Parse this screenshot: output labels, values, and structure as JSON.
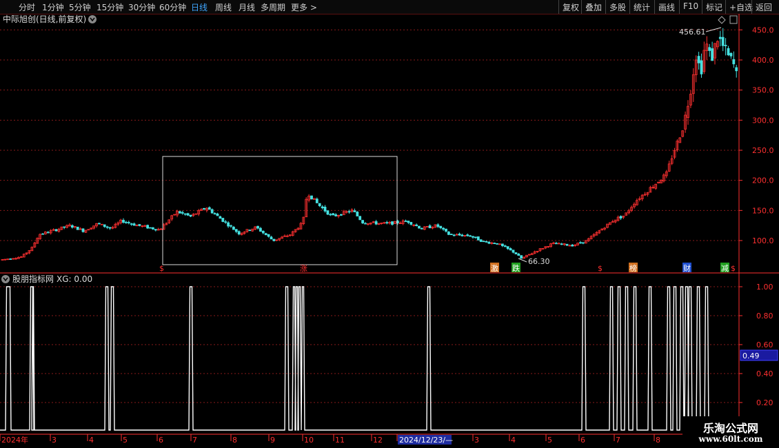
{
  "toolbar": {
    "left": [
      "分时",
      "1分钟",
      "5分钟",
      "15分钟",
      "30分钟",
      "60分钟",
      "日线",
      "周线",
      "月线",
      "多周期",
      "更多 >"
    ],
    "active": "日线",
    "right": [
      "复权",
      "叠加",
      "多股",
      "统计",
      "画线",
      "F10",
      "标记",
      "+自选",
      "返回"
    ]
  },
  "colors": {
    "up": "#ff3030",
    "down": "#45e0e0",
    "grid": "#8a1a1a",
    "axis": "#ff3030",
    "indicator": "#ffffff",
    "date_highlight": "#1e2ca0"
  },
  "main_chart": {
    "title": "中际旭创(日线,前复权)",
    "y_ticks": [
      "450.0",
      "400.0",
      "350.0",
      "300.0",
      "250.0",
      "200.0",
      "150.0",
      "100.0"
    ],
    "y_tick_values": [
      450,
      400,
      350,
      300,
      250,
      200,
      150,
      100
    ],
    "high_label": "456.61",
    "low_label": "66.30",
    "markers": [
      {
        "text": "$",
        "color": "#ff3030",
        "bg": ""
      },
      {
        "text": "涨",
        "color": "#ff3030",
        "bg": ""
      },
      {
        "text": "激",
        "color": "#ffffff",
        "bg": "#d07020"
      },
      {
        "text": "跌",
        "color": "#ffffff",
        "bg": "#20a020"
      },
      {
        "text": "$",
        "color": "#ff3030",
        "bg": ""
      },
      {
        "text": "榜",
        "color": "#ffffff",
        "bg": "#d07020"
      },
      {
        "text": "财",
        "color": "#ffffff",
        "bg": "#2050d0"
      },
      {
        "text": "减",
        "color": "#ffffff",
        "bg": "#20a020"
      },
      {
        "text": "$",
        "color": "#ff3030",
        "bg": ""
      }
    ]
  },
  "indicator": {
    "title": "股朋指标网",
    "xg_label": "XG: 0.00",
    "y_ticks": [
      "1.00",
      "0.80",
      "0.60",
      "0.40",
      "0.20"
    ],
    "y_tick_values": [
      1.0,
      0.8,
      0.6,
      0.4,
      0.2
    ],
    "cursor_value": "0.49"
  },
  "x_axis": {
    "labels": [
      "2024年",
      "3",
      "4",
      "5",
      "6",
      "7",
      "8",
      "9",
      "10",
      "11",
      "12",
      "2024/12/23/—",
      "3",
      "4",
      "5",
      "6",
      "7",
      "8"
    ],
    "highlight": "2024/12/23/—"
  },
  "watermark": {
    "line1": "乐淘公式网",
    "line2": "www.60lt.com"
  },
  "chart_data": {
    "type": "candlestick",
    "title": "中际旭创(日线,前复权)",
    "ylim": [
      55,
      470
    ],
    "approx_close_path": [
      [
        "2024-01",
        68
      ],
      [
        "2024-02",
        75
      ],
      [
        "2024-02",
        110
      ],
      [
        "2024-03",
        122
      ],
      [
        "2024-04",
        118
      ],
      [
        "2024-05",
        130
      ],
      [
        "2024-06",
        122
      ],
      [
        "2024-07",
        148
      ],
      [
        "2024-07",
        152
      ],
      [
        "2024-08",
        118
      ],
      [
        "2024-09",
        100
      ],
      [
        "2024-10",
        180
      ],
      [
        "2024-10",
        150
      ],
      [
        "2024-11",
        125
      ],
      [
        "2024-12",
        128
      ],
      [
        "2025-01",
        118
      ],
      [
        "2025-02",
        100
      ],
      [
        "2025-04",
        70
      ],
      [
        "2025-05",
        98
      ],
      [
        "2025-06",
        128
      ],
      [
        "2025-06",
        155
      ],
      [
        "2025-07",
        200
      ],
      [
        "2025-07",
        240
      ],
      [
        "2025-08",
        300
      ],
      [
        "2025-08",
        415
      ],
      [
        "2025-08",
        456.61
      ],
      [
        "2025-09",
        380
      ]
    ],
    "indicator_series": {
      "name": "XG",
      "values": "binary 0/1 spikes",
      "spike_groups": 17
    }
  }
}
